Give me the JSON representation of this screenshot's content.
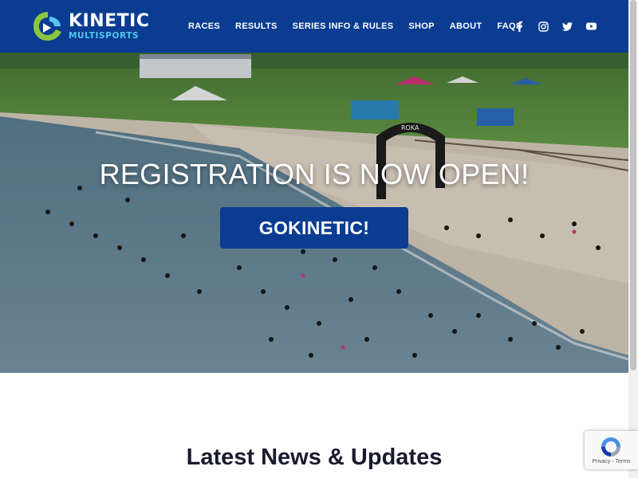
{
  "brand": {
    "name": "KINETIC",
    "subname": "MULTISPORTS",
    "colors": {
      "primary": "#0a3d91",
      "accent": "#54c6ef",
      "logo_green": "#8dc63f"
    }
  },
  "nav": {
    "items": [
      {
        "label": "RACES"
      },
      {
        "label": "RESULTS"
      },
      {
        "label": "SERIES INFO & RULES"
      },
      {
        "label": "SHOP"
      },
      {
        "label": "ABOUT"
      },
      {
        "label": "FAQS"
      }
    ]
  },
  "social": [
    {
      "icon": "facebook-icon"
    },
    {
      "icon": "instagram-icon"
    },
    {
      "icon": "twitter-icon"
    },
    {
      "icon": "youtube-icon"
    }
  ],
  "hero": {
    "title": "REGISTRATION IS NOW OPEN!",
    "button_label": "GOKINETIC!",
    "arch_text": "ROKA"
  },
  "main": {
    "section_title": "Latest News & Updates"
  },
  "recaptcha": {
    "links": "Privacy - Terms"
  }
}
